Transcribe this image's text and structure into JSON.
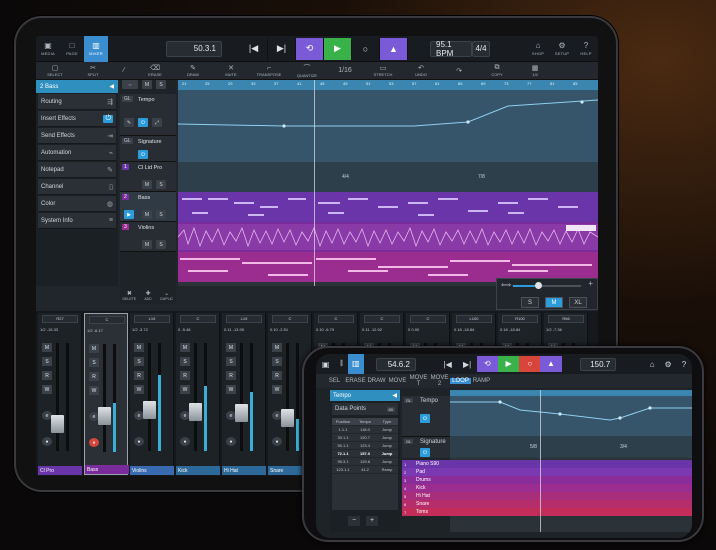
{
  "tablet": {
    "topbar": {
      "left_icons": [
        {
          "icon": "media-icon",
          "label": "MEDIA"
        },
        {
          "icon": "stop-square-icon",
          "label": "PAGE"
        },
        {
          "icon": "mixer-icon",
          "label": "MIXER"
        }
      ],
      "position": "50.3.1",
      "tempo": "95.1 BPM",
      "signature": "4/4",
      "right_icons": [
        {
          "icon": "shop-icon",
          "label": "SHOP"
        },
        {
          "icon": "gear-icon",
          "label": "SETUP"
        },
        {
          "icon": "help-icon",
          "label": "HELP"
        }
      ]
    },
    "toolbar": [
      {
        "icon": "select-icon",
        "label": "SELECT"
      },
      {
        "icon": "split-icon",
        "label": "SPLIT"
      },
      {
        "icon": "glue-icon",
        "label": ""
      },
      {
        "icon": "erase-icon",
        "label": "ERASE"
      },
      {
        "icon": "draw-icon",
        "label": "DRAW"
      },
      {
        "icon": "mute-icon",
        "label": "MUTE"
      },
      {
        "icon": "transpose-icon",
        "label": "TRANSPOSE"
      },
      {
        "icon": "quantize-icon",
        "label": "QUANTIZE"
      },
      {
        "icon": "grid-icon",
        "label": "1/16"
      },
      {
        "icon": "stretch-icon",
        "label": "STRETCH"
      },
      {
        "icon": "undo-icon",
        "label": "UNDO"
      },
      {
        "icon": "redo-icon",
        "label": ""
      },
      {
        "icon": "copy-icon",
        "label": "COPY"
      },
      {
        "icon": "grid-icon",
        "label": "1/4"
      }
    ],
    "left_panel": {
      "header": "2 Bass",
      "items": [
        {
          "label": "Routing",
          "icon": "routing-icon"
        },
        {
          "label": "Insert Effects",
          "icon": "power-icon"
        },
        {
          "label": "Send Effects",
          "icon": "send-icon"
        },
        {
          "label": "Automation",
          "icon": "automation-icon"
        },
        {
          "label": "Notepad",
          "icon": "notepad-icon"
        },
        {
          "label": "Channel",
          "icon": "channel-icon"
        },
        {
          "label": "Color",
          "icon": "palette-icon"
        },
        {
          "label": "System Info",
          "icon": "list-icon"
        }
      ]
    },
    "tracks": [
      {
        "num": "GL",
        "name": "Tempo"
      },
      {
        "num": "GL",
        "name": "Signature"
      },
      {
        "num": "1",
        "name": "Cl Lid Pro"
      },
      {
        "num": "2",
        "name": "Bass"
      },
      {
        "num": "3",
        "name": "Violins"
      }
    ],
    "ruler_marks": [
      "21",
      "25",
      "29",
      "33",
      "37",
      "41",
      "45",
      "49",
      "51",
      "53",
      "57",
      "61",
      "65",
      "69",
      "73",
      "77",
      "81",
      "85"
    ],
    "signature_marks": [
      "4/4",
      "7/8"
    ],
    "bottom_tools": [
      {
        "icon": "delete-icon",
        "label": "DELETE"
      },
      {
        "icon": "add-icon",
        "label": "ADD"
      },
      {
        "icon": "duplicate-icon",
        "label": "DUPLIC"
      }
    ],
    "size_buttons": [
      "S",
      "M",
      "XL"
    ],
    "mixer": [
      {
        "pan": "R27",
        "db1": "1/2",
        "db2": "-15.33",
        "name": "Cl Pro",
        "meter": 0.0
      },
      {
        "pan": "C",
        "db1": "1/2",
        "db2": "-6.17",
        "name": "Bass",
        "meter": 0.45,
        "selected": true
      },
      {
        "pan": "L19",
        "db1": "1/2",
        "db2": "-3.72",
        "name": "Violins",
        "meter": 0.7
      },
      {
        "pan": "C",
        "db1": "0",
        "db2": "-5.48",
        "name": "Kick",
        "meter": 0.6
      },
      {
        "pan": "L19",
        "db1": "0.11",
        "db2": "-13.95",
        "name": "Hi Hat",
        "meter": 0.55
      },
      {
        "pan": "C",
        "db1": "0.10",
        "db2": "-2.51",
        "name": "Snare",
        "meter": 0.3
      },
      {
        "pan": "C",
        "db1": "0.10",
        "db2": "-6.79",
        "name": "",
        "meter": 0.0
      },
      {
        "pan": "C",
        "db1": "0.11",
        "db2": "-12.92",
        "name": "",
        "meter": 0.0
      },
      {
        "pan": "C",
        "db1": "0",
        "db2": "0.00",
        "name": "",
        "meter": 0.0
      },
      {
        "pan": "L100",
        "db1": "0.18",
        "db2": "-18.84",
        "name": "",
        "meter": 0.0
      },
      {
        "pan": "R100",
        "db1": "0.18",
        "db2": "-18.84",
        "name": "",
        "meter": 0.0
      },
      {
        "pan": "R66",
        "db1": "1/2",
        "db2": "-7.36",
        "name": "",
        "meter": 0.0
      }
    ]
  },
  "phone": {
    "position": "54.6.2",
    "tempo": "150.7",
    "toolbar": [
      "SEL",
      "ERASE",
      "DRAW",
      "MOVE",
      "MOVE T",
      "MOVE 2",
      "LOOP",
      "RAMP"
    ],
    "tempo_header": "Tempo",
    "data_points_label": "Data Points",
    "data_points_count": "80",
    "table_headers": [
      "Position",
      "Tempo",
      "Type"
    ],
    "table_rows": [
      [
        "1.1.1",
        "118.0",
        "Jump"
      ],
      [
        "33.1.1",
        "120.7",
        "Jump"
      ],
      [
        "55.1.1",
        "123.4",
        "Jump"
      ],
      [
        "72.1.1",
        "157.0",
        "Jump"
      ],
      [
        "95.3.1",
        "129.8",
        "Jump"
      ],
      [
        "123.1.1",
        "41.2",
        "Ramp"
      ]
    ],
    "tracks": [
      {
        "num": "GL",
        "name": "Tempo"
      },
      {
        "num": "GL",
        "name": "Signature"
      },
      {
        "num": "1",
        "name": "Piano S90"
      },
      {
        "num": "2",
        "name": "Pad"
      },
      {
        "num": "3",
        "name": "Drums"
      },
      {
        "num": "4",
        "name": "Kick"
      },
      {
        "num": "5",
        "name": "Hi Hat"
      },
      {
        "num": "6",
        "name": "Snare"
      },
      {
        "num": "7",
        "name": "Toms"
      }
    ],
    "signature_marks": [
      "5/8",
      "3/4"
    ]
  }
}
